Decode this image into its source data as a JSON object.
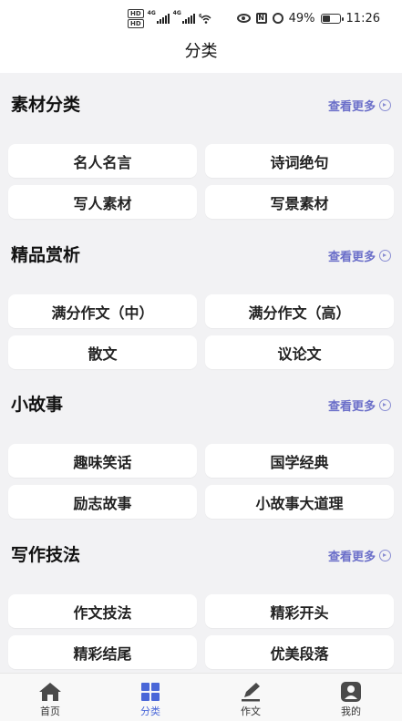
{
  "status_bar": {
    "hd_top": "HD",
    "hd_bottom": "HD",
    "sig1_tag": "4G",
    "sig2_tag": "4G",
    "wifi_tag": "6",
    "battery": "49%",
    "time": "11:26",
    "battery_level": 0.49
  },
  "page": {
    "title": "分类"
  },
  "more_label": "查看更多",
  "sections": [
    {
      "title": "素材分类",
      "items": [
        "名人名言",
        "诗词绝句",
        "写人素材",
        "写景素材"
      ]
    },
    {
      "title": "精品赏析",
      "items": [
        "满分作文（中）",
        "满分作文（高）",
        "散文",
        "议论文"
      ]
    },
    {
      "title": "小故事",
      "items": [
        "趣味笑话",
        "国学经典",
        "励志故事",
        "小故事大道理"
      ]
    },
    {
      "title": "写作技法",
      "items": [
        "作文技法",
        "精彩开头",
        "精彩结尾",
        "优美段落"
      ]
    }
  ],
  "tabs": [
    {
      "label": "首页",
      "icon": "home-icon"
    },
    {
      "label": "分类",
      "icon": "grid-icon",
      "active": true
    },
    {
      "label": "作文",
      "icon": "pencil-icon"
    },
    {
      "label": "我的",
      "icon": "profile-icon"
    }
  ],
  "colors": {
    "accent": "#4a67d8",
    "more_link": "#6b6fc9",
    "background": "#f2f2f4"
  }
}
